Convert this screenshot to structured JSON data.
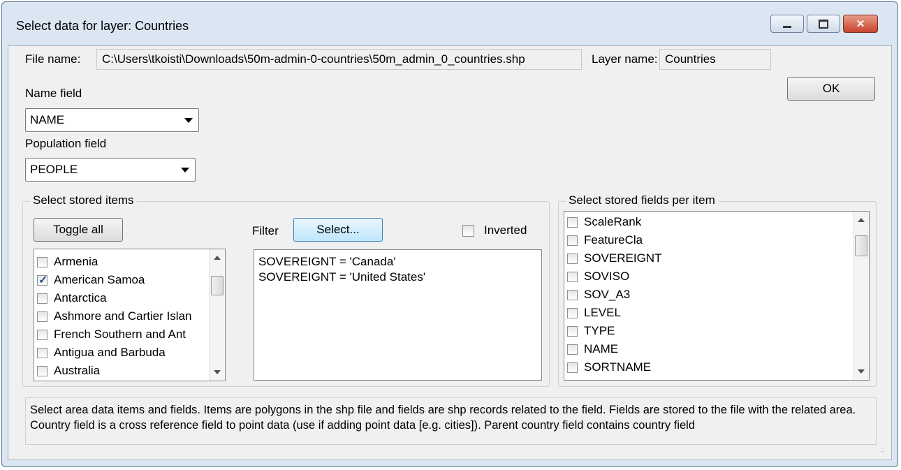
{
  "window": {
    "title": "Select data for layer: Countries",
    "minimize_icon": "minimize-icon",
    "maximize_icon": "maximize-icon",
    "close_icon": "close-icon"
  },
  "file": {
    "label": "File name:",
    "value": "C:\\Users\\tkoisti\\Downloads\\50m-admin-0-countries\\50m_admin_0_countries.shp"
  },
  "layer": {
    "label": "Layer name:",
    "value": "Countries"
  },
  "ok_label": "OK",
  "name_field": {
    "label": "Name field",
    "value": "NAME"
  },
  "population_field": {
    "label": "Population field",
    "value": "PEOPLE"
  },
  "stored_items": {
    "title": "Select stored items",
    "toggle_label": "Toggle all",
    "filter_label": "Filter",
    "select_label": "Select...",
    "inverted_label": "Inverted",
    "inverted_checked": false,
    "items": [
      {
        "label": "Armenia",
        "checked": false
      },
      {
        "label": "American Samoa",
        "checked": true
      },
      {
        "label": "Antarctica",
        "checked": false
      },
      {
        "label": "Ashmore and Cartier Islan",
        "checked": false
      },
      {
        "label": "French Southern and Ant",
        "checked": false
      },
      {
        "label": "Antigua and Barbuda",
        "checked": false
      },
      {
        "label": "Australia",
        "checked": false
      }
    ],
    "filter_lines": [
      "SOVEREIGNT = 'Canada'",
      "SOVEREIGNT = 'United States'"
    ]
  },
  "stored_fields": {
    "title": "Select stored fields per item",
    "items": [
      {
        "label": "ScaleRank",
        "checked": false
      },
      {
        "label": "FeatureCla",
        "checked": false
      },
      {
        "label": "SOVEREIGNT",
        "checked": false
      },
      {
        "label": "SOVISO",
        "checked": false
      },
      {
        "label": "SOV_A3",
        "checked": false
      },
      {
        "label": "LEVEL",
        "checked": false
      },
      {
        "label": "TYPE",
        "checked": false
      },
      {
        "label": "NAME",
        "checked": false
      },
      {
        "label": "SORTNAME",
        "checked": false
      }
    ]
  },
  "help_text": "Select area data items and fields. Items are polygons in the shp file and fields are shp records related to the field. Fields are stored to the file with the related area. Country field is a cross reference field to point data (use if adding point data [e.g. cities]). Parent country field contains country field"
}
